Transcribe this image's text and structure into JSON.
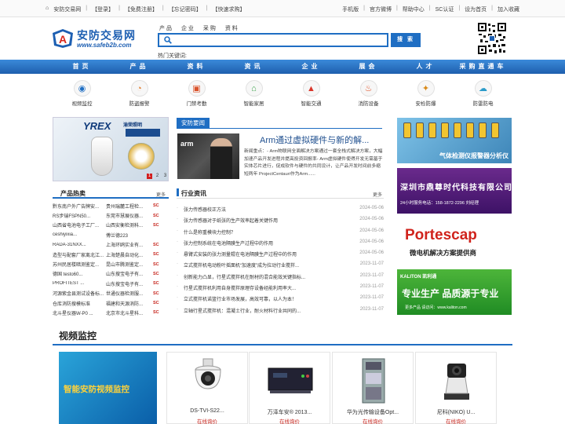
{
  "topbar": {
    "site": "安防交易网",
    "login": "【登录】",
    "register": "【免费注册】",
    "forgot": "【忘记密码】",
    "quick_buy": "【快速求购】",
    "right_links": [
      "手机版",
      "官方微博",
      "帮助中心",
      "SC认证",
      "设为首页",
      "加入收藏"
    ]
  },
  "logo": {
    "name": "安防交易网",
    "url": "www.safeb2b.com"
  },
  "search": {
    "tabs": [
      "产 品",
      "企 业",
      "采 购",
      "资 料"
    ],
    "placeholder": "",
    "button": "搜 索",
    "hot_label": "热门关键词:"
  },
  "nav": [
    "首页",
    "产品",
    "资料",
    "资讯",
    "企业",
    "展会",
    "人才",
    "采购直通车"
  ],
  "categories": [
    {
      "label": "视频监控",
      "icon": "camera-icon"
    },
    {
      "label": "防盗报警",
      "icon": "alarm-icon"
    },
    {
      "label": "门禁考勤",
      "icon": "door-icon"
    },
    {
      "label": "智能家居",
      "icon": "home-icon"
    },
    {
      "label": "智能交通",
      "icon": "traffic-icon"
    },
    {
      "label": "消防设备",
      "icon": "fire-icon"
    },
    {
      "label": "安检防爆",
      "icon": "security-check-icon"
    },
    {
      "label": "防雷防电",
      "icon": "lightning-icon"
    }
  ],
  "banner": {
    "brand": "YREX",
    "brand_cn": "渝荣照明",
    "pages": [
      "1",
      "2",
      "3"
    ]
  },
  "hot_products": {
    "title": "产品热卖",
    "more": "更多",
    "rows": [
      {
        "product": "黔东南户外广告牌安...",
        "company": "贵州瑞麓工程检...",
        "tag": "SC"
      },
      {
        "product": "RS步瑞FSPN50...",
        "company": "东莞市慧展仪器...",
        "tag": "SC"
      },
      {
        "product": "山西省电池电子工厂...",
        "company": "山西安衡检测科...",
        "tag": "SC"
      },
      {
        "product": "ceshiyixia...",
        "company": "傅兰德223",
        "tag": ""
      },
      {
        "product": "RADA-31NXX...",
        "company": "上海环鸥实业有...",
        "tag": "SC"
      },
      {
        "product": "造型与配套厂家离北江...",
        "company": "上海楚晨自动化...",
        "tag": "SC"
      },
      {
        "product": "苏州民居楼暗测鉴定...",
        "company": "昆山市腾测鉴定...",
        "tag": "SC"
      },
      {
        "product": "德国 testo60...",
        "company": "山东搜宝电子有...",
        "tag": "SC"
      },
      {
        "product": "PROFITEST ...",
        "company": "山东搜宝电子有...",
        "tag": "SC"
      },
      {
        "product": "河源紫金县测试设备标...",
        "company": "世通仪器检测服...",
        "tag": "SC"
      },
      {
        "product": "仓库消防搜模标准",
        "company": "福建和天源消防...",
        "tag": "SC"
      },
      {
        "product": "北斗星仪器W-P0 ...",
        "company": "北京市北斗星科...",
        "tag": "SC"
      }
    ]
  },
  "news": {
    "tab": "安防要闻",
    "image_text": "arm",
    "title": "Arm通过虚拟硬件与新的解...",
    "summary": "新闻重点：- Arm物联网全面解决方案通过一套全栈式解决方案，大幅加速产品开发进程并提高投资回报率- Arm虚拟硬件使得开发无需基于实体芯片进行，促成软件与硬件的共同设计，让产品开发时间前多缩短两年 ProjectCentauri作为Arm......"
  },
  "industry_news": {
    "title": "行业资讯",
    "more": "更多",
    "rows": [
      {
        "title": "张力传感器校正方法",
        "date": "2024-05-06"
      },
      {
        "title": "张力传感器对于纸张的生产效率起着关键作用",
        "date": "2024-05-06"
      },
      {
        "title": "什么是称重模块力控制？",
        "date": "2024-05-06"
      },
      {
        "title": "张力控制系统在电池隔膜生产过程中的作用",
        "date": "2024-05-06"
      },
      {
        "title": "悬臂式安装的张力测量辊在电池隔膜生产过程中的作用",
        "date": "2024-05-06"
      },
      {
        "title": "立式搅拌机电动粉叶摇面机“加速度”成为拉动行业搅拌...",
        "date": "2023-11-07"
      },
      {
        "title": "创新能力凸显，行星式搅拌机在耐材的混合能效关键指标...",
        "date": "2023-11-07"
      },
      {
        "title": "行星式搅拌机利用自身搅拌原理存设备经能利用率大...",
        "date": "2023-11-07"
      },
      {
        "title": "立式搅拌机诺篮行业市场发展，高效可靠，以人为本！",
        "date": "2023-11-07"
      },
      {
        "title": "立轴行星式搅拌机：混凝土行业，耐火材料行业共同的...",
        "date": "2023-11-07"
      }
    ]
  },
  "ads": {
    "ad1": "气体检测仪报警器分析仪",
    "ad2_title": "深圳市鼎尊时代科技有限公司",
    "ad2_sub": "24小时服务电话：158-1872-2296 刘经理",
    "ad3_title": "Portescap",
    "ad3_sub": "微电机解决方案提供商",
    "ad4_brand": "KALITON 凯利通",
    "ad4_title": "专业生产 品质源于专业",
    "ad4_sub": "更多产品 请访问：www.kaliton.com"
  },
  "video": {
    "title": "视频监控",
    "banner_text": "智能安防视频监控",
    "products": [
      {
        "name": "DS-TVI-S22...",
        "price": "在线询价"
      },
      {
        "name": "万泽车安® 2013...",
        "price": "在线询价"
      },
      {
        "name": "华为光传输设备Opt...",
        "price": "在线询价"
      },
      {
        "name": "尼科(NIKO) U...",
        "price": "在线询价"
      }
    ]
  }
}
